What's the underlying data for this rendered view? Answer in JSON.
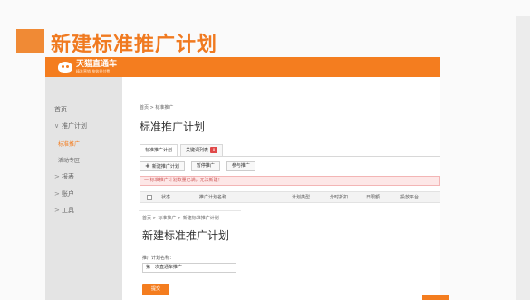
{
  "slide": {
    "title": "新建标准推广计划"
  },
  "app": {
    "logo_main": "天猫直通车",
    "logo_sub": "精准营销 按效果付费"
  },
  "sidebar": {
    "items": [
      {
        "label": "首页"
      },
      {
        "label": "推广计划"
      },
      {
        "label": "标准推广"
      },
      {
        "label": "活动专区"
      },
      {
        "label": "报表"
      },
      {
        "label": "账户"
      },
      {
        "label": "工具"
      }
    ]
  },
  "main": {
    "breadcrumb": "首页  >  标准推广",
    "title": "标准推广计划",
    "tabs": [
      {
        "label": "标准推广计划"
      },
      {
        "label": "关键词列表"
      }
    ],
    "tab_badge": "8",
    "buttons": {
      "new": "新建推广计划",
      "pause": "暂停推广",
      "join": "参与推广"
    },
    "alert": "标准推广计划数量已满，无法新建！",
    "table_headers": [
      "状态",
      "推广计划名称",
      "计划类型",
      "分时折扣",
      "日限额",
      "投放平台"
    ]
  },
  "overlay": {
    "breadcrumb": "首页  >  标准推广  >  新建标准推广计划",
    "title": "新建标准推广计划",
    "field_label": "推广计划名称：",
    "field_value": "第一次直通车推广",
    "submit": "提交"
  },
  "colors": {
    "accent": "#f47d1f",
    "slide_accent": "#f08a35"
  }
}
